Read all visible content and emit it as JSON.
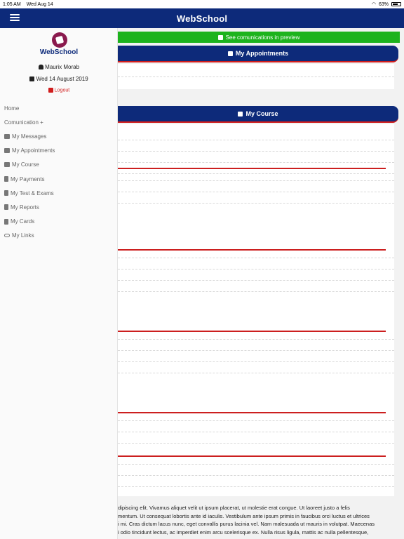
{
  "status": {
    "time": "1:05 AM",
    "date": "Wed Aug 14",
    "battery": "63%"
  },
  "app": {
    "title": "WebSchool"
  },
  "sidebar": {
    "brand": "WebSchool",
    "user": "Maurix Morab",
    "date": "Wed 14 August 2019",
    "logout": "Logout",
    "items": [
      {
        "label": "Home",
        "icon": ""
      },
      {
        "label": "Comunication +",
        "icon": ""
      },
      {
        "label": "My Messages",
        "icon": "inbox-icon"
      },
      {
        "label": "My Appointments",
        "icon": "calendar-icon"
      },
      {
        "label": "My Course",
        "icon": "chalkboard-icon"
      },
      {
        "label": "My Payments",
        "icon": "receipt-icon"
      },
      {
        "label": "My Test & Exams",
        "icon": "book-icon"
      },
      {
        "label": "My Reports",
        "icon": "book-icon"
      },
      {
        "label": "My Cards",
        "icon": "id-card-icon"
      },
      {
        "label": "My Links",
        "icon": "link-icon"
      }
    ]
  },
  "content": {
    "preview_label": "See comunications in preview",
    "appointments_title": "My Appointments",
    "course_title": "My Course",
    "lorem_lines": [
      "dipiscing elit. Vivamus aliquet velit ut ipsum placerat, ut molestie erat congue. Ut laoreet justo a felis",
      "mentum. Ut consequat lobortis ante id iaculis. Vestibulum ante ipsum primis in faucibus orci luctus et ultrices",
      "i mi. Cras dictum lacus nunc, eget convallis purus lacinia vel. Nam malesuada ut mauris in volutpat. Maecenas",
      "i odio tincidunt lectus, ac imperdiet enim arcu scelerisque ex. Nulla risus ligula, mattis ac nulla pellentesque,"
    ]
  },
  "colors": {
    "nav": "#0d2a7a",
    "accent_red": "#d01c1c",
    "preview_green": "#1db31d"
  }
}
